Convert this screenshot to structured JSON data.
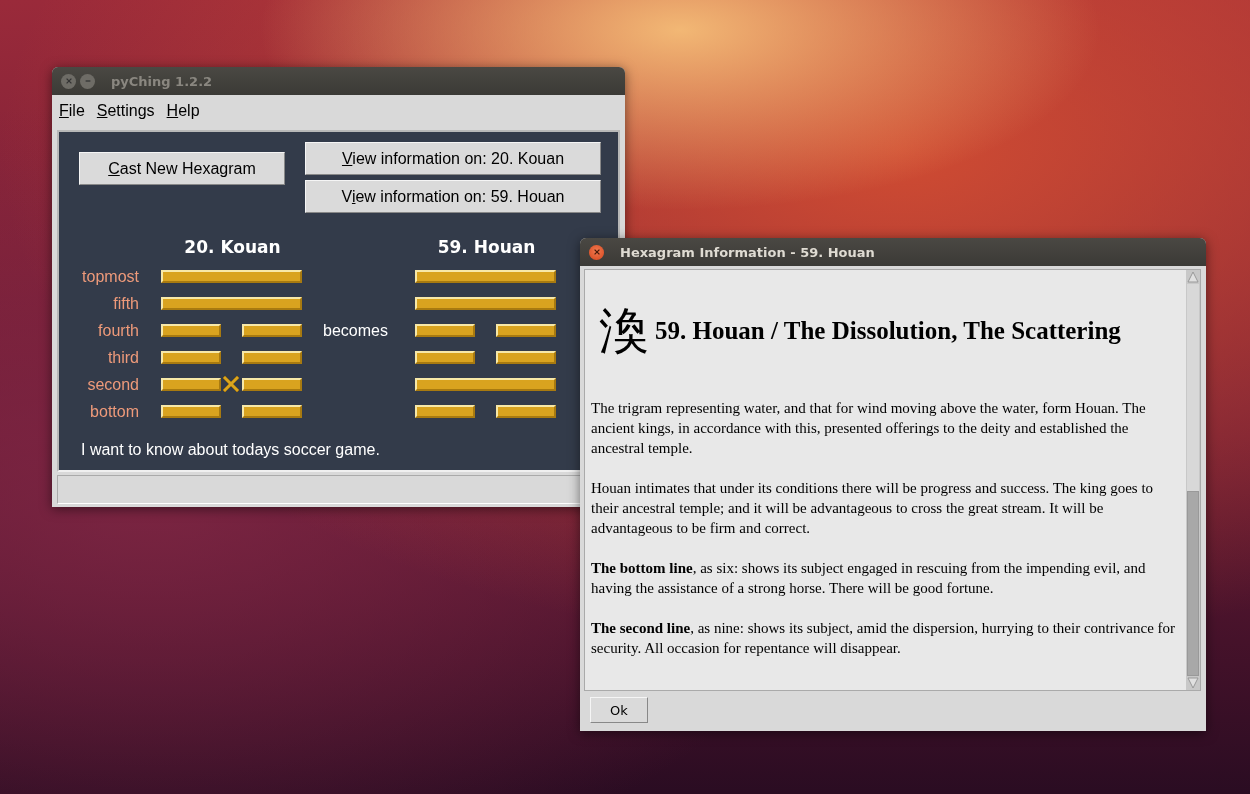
{
  "main_window": {
    "title": "pyChing  1.2.2",
    "menu": [
      {
        "key": "F",
        "after": "ile"
      },
      {
        "key": "S",
        "after": "ettings"
      },
      {
        "key": "H",
        "after": "elp"
      }
    ],
    "cast_button": {
      "key": "C",
      "after": "ast New Hexagram"
    },
    "info_buttons": [
      {
        "key": "V",
        "after": "iew information on:  20. Kouan"
      },
      {
        "before": "V",
        "key": "i",
        "after": "ew information on:  59. Houan"
      }
    ],
    "line_labels": [
      "topmost",
      "fifth",
      "fourth",
      "third",
      "second",
      "bottom"
    ],
    "hexagrams": [
      {
        "title": "20.  Kouan",
        "lines": [
          {
            "kind": "yang",
            "changing": false
          },
          {
            "kind": "yang",
            "changing": false
          },
          {
            "kind": "yin",
            "changing": false
          },
          {
            "kind": "yin",
            "changing": false
          },
          {
            "kind": "yin",
            "changing": true
          },
          {
            "kind": "yin",
            "changing": false
          }
        ]
      },
      {
        "title": "59.  Houan",
        "lines": [
          {
            "kind": "yang",
            "changing": false
          },
          {
            "kind": "yang",
            "changing": false
          },
          {
            "kind": "yin",
            "changing": false
          },
          {
            "kind": "yin",
            "changing": false
          },
          {
            "kind": "yang",
            "changing": false
          },
          {
            "kind": "yin",
            "changing": false
          }
        ]
      }
    ],
    "becomes": "becomes",
    "question": "I want to know about todays soccer game."
  },
  "info_window": {
    "title": "Hexagram Information - 59. Houan",
    "glyph": "渙",
    "heading": "59. Houan / The Dissolution, The Scattering",
    "paragraphs": [
      "The trigram representing water, and that for wind moving above the water, form Houan. The ancient kings, in accordance with this, presented offerings to the deity and established the ancestral temple.",
      "Houan intimates that under its conditions there will be progress and success. The king goes to their ancestral temple; and it will be advantageous to cross the great stream. It will be advantageous to be firm and correct.",
      "**The bottom line**, as six: shows its subject engaged in rescuing from the impending evil, and having the assistance of a strong horse. There will be good fortune.",
      "**The second line**, as nine: shows its subject, amid the dispersion, hurrying to their contrivance for security. All occasion for repentance will disappear."
    ],
    "ok_button": "Ok"
  }
}
